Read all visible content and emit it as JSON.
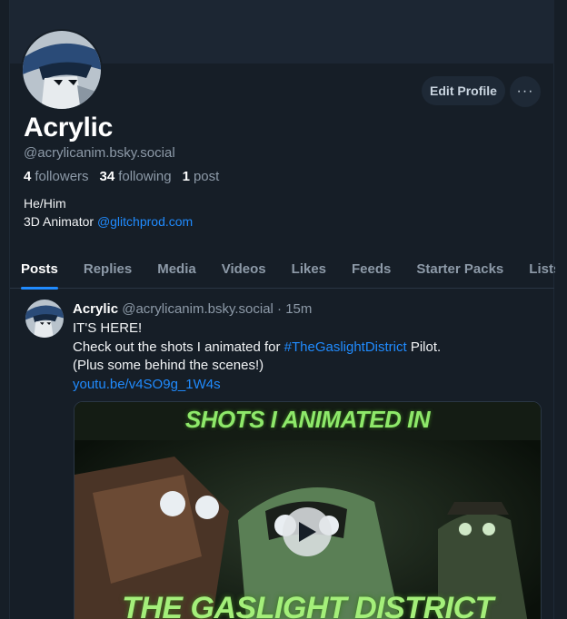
{
  "profile": {
    "display_name": "Acrylic",
    "handle": "@acrylicanim.bsky.social",
    "followers_count": "4",
    "followers_label": "followers",
    "following_count": "34",
    "following_label": "following",
    "posts_count": "1",
    "posts_label": "post",
    "bio_line1": "He/Him",
    "bio_line2_prefix": "3D Animator ",
    "bio_line2_link": "@glitchprod.com",
    "edit_label": "Edit Profile",
    "more_label": "···"
  },
  "tabs": [
    "Posts",
    "Replies",
    "Media",
    "Videos",
    "Likes",
    "Feeds",
    "Starter Packs",
    "Lists"
  ],
  "post": {
    "author_name": "Acrylic",
    "author_handle": "@acrylicanim.bsky.social",
    "separator": " · ",
    "time": "15m",
    "line1": "IT'S HERE!",
    "line2_prefix": "Check out the shots I animated for ",
    "line2_tag": "#TheGaslightDistrict",
    "line2_suffix": " Pilot.",
    "line3": "(Plus some behind the scenes!)",
    "link": "youtu.be/v4SO9g_1W4s",
    "thumb_title_top": "SHOTS I ANIMATED IN",
    "thumb_title_bottom": "THE GASLIGHT DISTRICT"
  },
  "colors": {
    "background": "#161e27",
    "accent": "#208bfe",
    "muted_text": "#8d9aa8"
  }
}
